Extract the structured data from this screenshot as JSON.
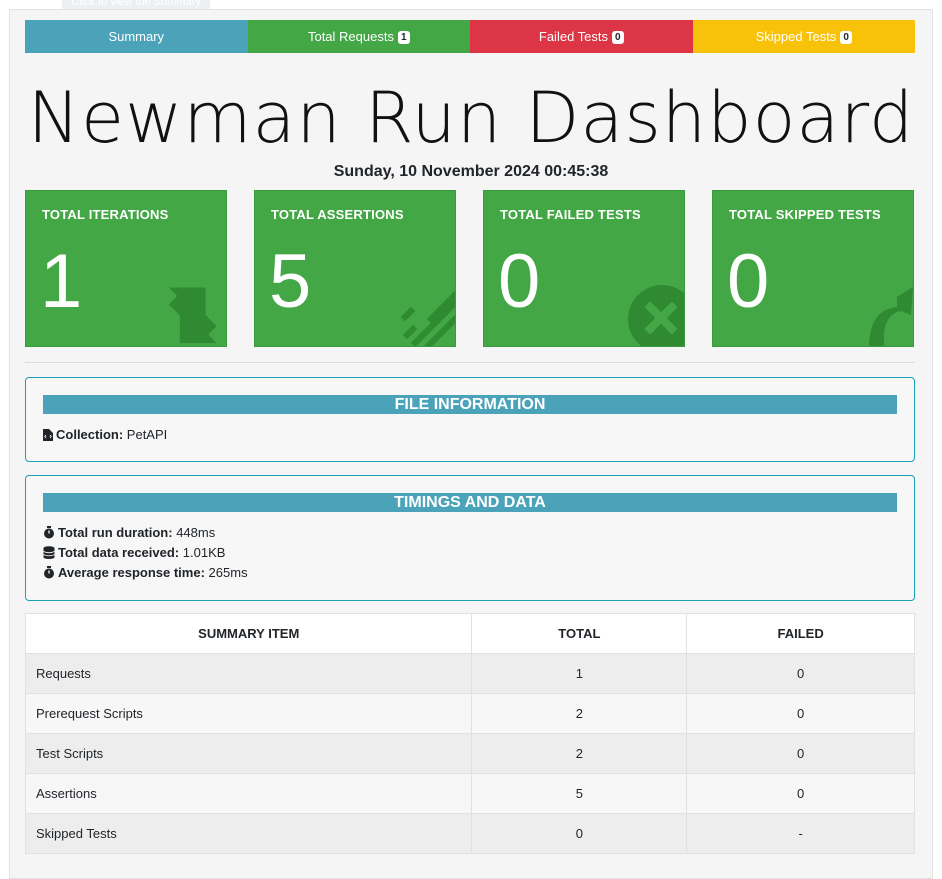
{
  "tooltip": "Click to view the Summary",
  "tabs": [
    {
      "label": "Summary",
      "badge": null,
      "color": "#4ba3b9"
    },
    {
      "label": "Total Requests",
      "badge": "1",
      "color": "#43a745"
    },
    {
      "label": "Failed Tests",
      "badge": "0",
      "color": "#dc3545"
    },
    {
      "label": "Skipped Tests",
      "badge": "0",
      "color": "#f8c20b"
    }
  ],
  "title": "Newman Run Dashboard",
  "timestamp": "Sunday, 10 November 2024 00:45:38",
  "cards": [
    {
      "title": "TOTAL ITERATIONS",
      "value": "1",
      "icon": "sync-icon"
    },
    {
      "title": "TOTAL ASSERTIONS",
      "value": "5",
      "icon": "tasks-icon"
    },
    {
      "title": "TOTAL FAILED TESTS",
      "value": "0",
      "icon": "times-circle-icon"
    },
    {
      "title": "TOTAL SKIPPED TESTS",
      "value": "0",
      "icon": "share-icon"
    }
  ],
  "file_info": {
    "heading": "FILE INFORMATION",
    "collection_label": "Collection:",
    "collection_value": "PetAPI"
  },
  "timings": {
    "heading": "TIMINGS AND DATA",
    "run_duration_label": "Total run duration:",
    "run_duration_value": "448ms",
    "data_received_label": "Total data received:",
    "data_received_value": "1.01KB",
    "avg_response_label": "Average response time:",
    "avg_response_value": "265ms"
  },
  "summary_table": {
    "headers": [
      "SUMMARY ITEM",
      "TOTAL",
      "FAILED"
    ],
    "rows": [
      [
        "Requests",
        "1",
        "0"
      ],
      [
        "Prerequest Scripts",
        "2",
        "0"
      ],
      [
        "Test Scripts",
        "2",
        "0"
      ],
      [
        "Assertions",
        "5",
        "0"
      ],
      [
        "Skipped Tests",
        "0",
        "-"
      ]
    ]
  },
  "colors": {
    "card_green": "#43a745",
    "panel_border": "#17a2b8",
    "panel_heading": "#4ba3b9"
  }
}
